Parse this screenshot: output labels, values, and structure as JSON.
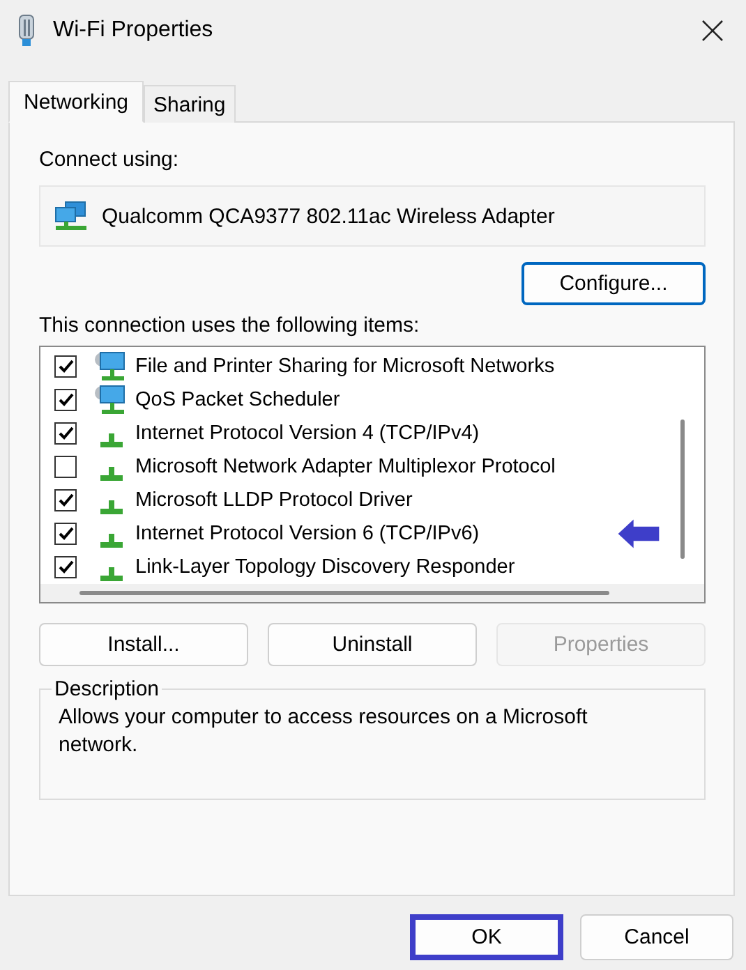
{
  "window": {
    "title": "Wi-Fi Properties"
  },
  "tabs": [
    {
      "label": "Networking",
      "selected": true
    },
    {
      "label": "Sharing",
      "selected": false
    }
  ],
  "connect_using": {
    "label": "Connect using:",
    "adapter": "Qualcomm QCA9377 802.11ac Wireless Adapter",
    "button": "Configure..."
  },
  "items_label": "This connection uses the following items:",
  "items": [
    {
      "label": "File and Printer Sharing for Microsoft Networks",
      "kind": "service",
      "checked": true,
      "pointed": false
    },
    {
      "label": "QoS Packet Scheduler",
      "kind": "service",
      "checked": true,
      "pointed": false
    },
    {
      "label": "Internet Protocol Version 4 (TCP/IPv4)",
      "kind": "protocol",
      "checked": true,
      "pointed": false
    },
    {
      "label": "Microsoft Network Adapter Multiplexor Protocol",
      "kind": "protocol",
      "checked": false,
      "pointed": false
    },
    {
      "label": "Microsoft LLDP Protocol Driver",
      "kind": "protocol",
      "checked": true,
      "pointed": false
    },
    {
      "label": "Internet Protocol Version 6 (TCP/IPv6)",
      "kind": "protocol",
      "checked": true,
      "pointed": true
    },
    {
      "label": "Link-Layer Topology Discovery Responder",
      "kind": "protocol",
      "checked": true,
      "pointed": false
    }
  ],
  "item_buttons": [
    {
      "label": "Install...",
      "disabled": false
    },
    {
      "label": "Uninstall",
      "disabled": false
    },
    {
      "label": "Properties",
      "disabled": true
    }
  ],
  "description": {
    "title": "Description",
    "text": "Allows your computer to access resources on a Microsoft network."
  },
  "footer_buttons": [
    {
      "label": "OK",
      "highlighted": true
    },
    {
      "label": "Cancel",
      "highlighted": false
    }
  ]
}
